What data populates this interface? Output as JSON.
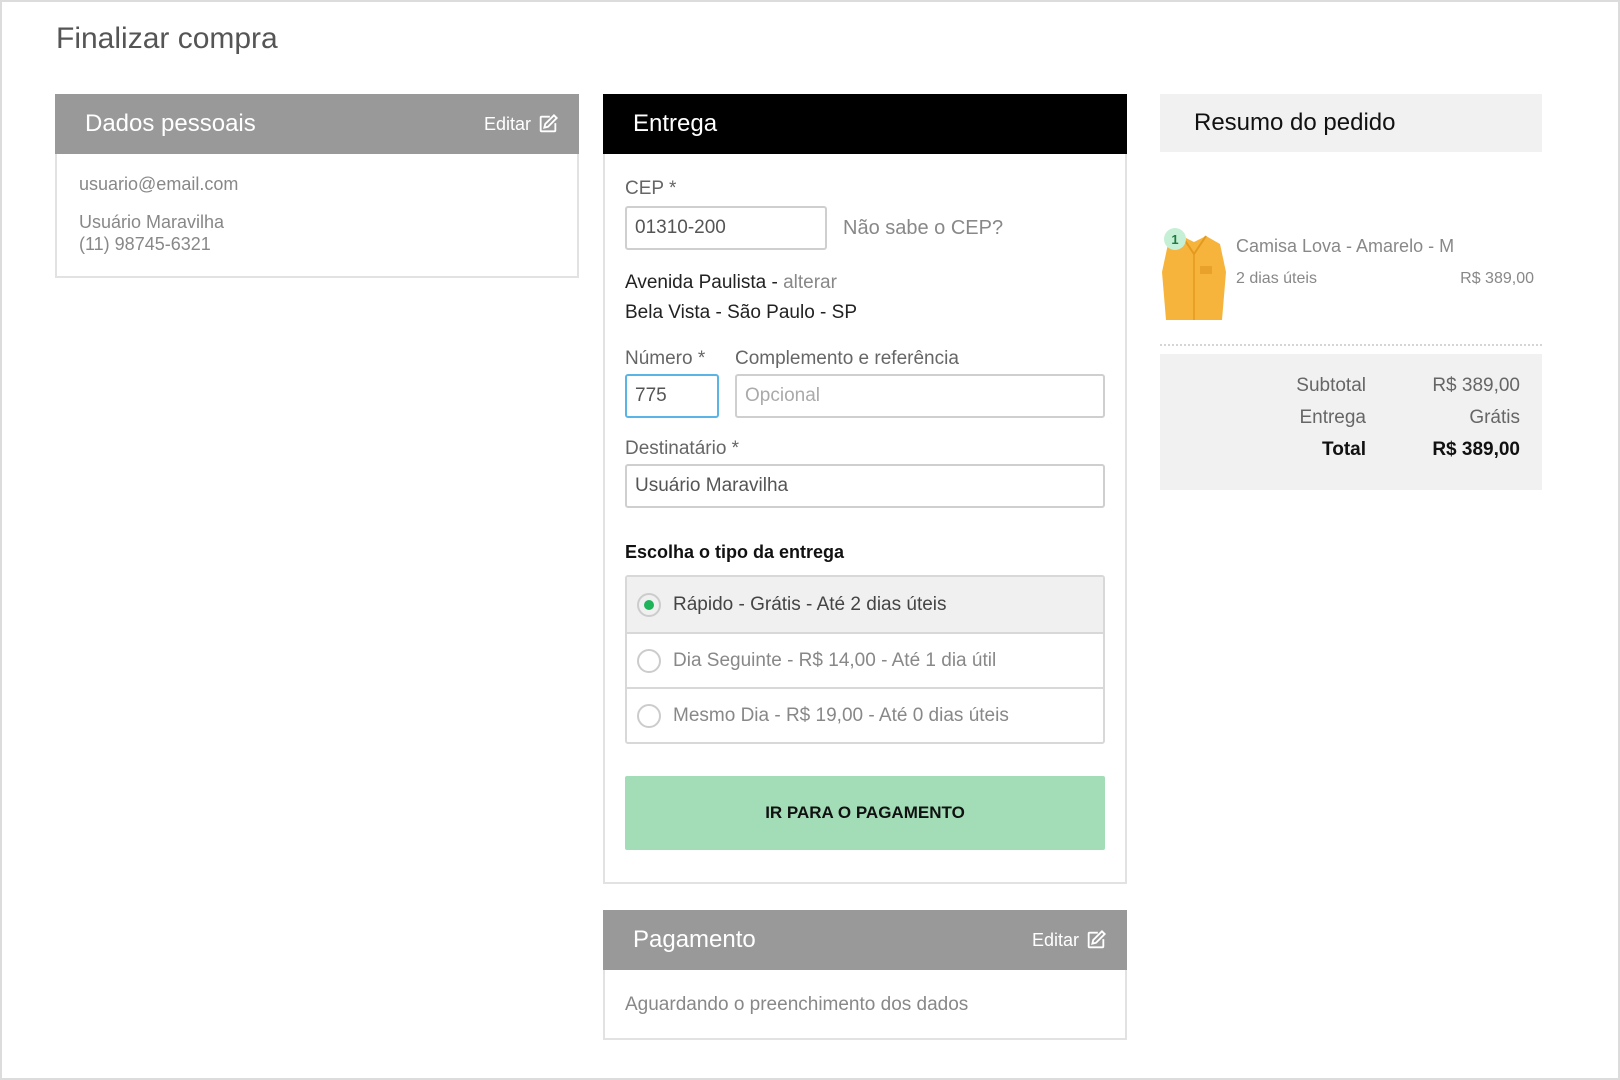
{
  "page": {
    "title": "Finalizar compra"
  },
  "personal": {
    "title": "Dados pessoais",
    "edit_label": "Editar",
    "email": "usuario@email.com",
    "name": "Usuário Maravilha",
    "phone": "(11) 98745-6321"
  },
  "delivery": {
    "title": "Entrega",
    "cep_label": "CEP *",
    "cep_value": "01310-200",
    "cep_help": "Não sabe o CEP?",
    "street": "Avenida Paulista -",
    "change_label": "alterar",
    "city_line": "Bela Vista - São Paulo - SP",
    "number_label": "Número *",
    "number_value": "775",
    "complement_label": "Complemento e referência",
    "complement_placeholder": "Opcional",
    "recipient_label": "Destinatário *",
    "recipient_value": "Usuário Maravilha",
    "shipping_title": "Escolha o tipo da entrega",
    "shipping_options": [
      {
        "label": "Rápido - Grátis - Até 2 dias úteis",
        "selected": true
      },
      {
        "label": "Dia Seguinte - R$ 14,00 - Até 1 dia útil",
        "selected": false
      },
      {
        "label": "Mesmo Dia - R$ 19,00 - Até 0 dias úteis",
        "selected": false
      }
    ],
    "pay_button": "IR PARA O PAGAMENTO"
  },
  "payment": {
    "title": "Pagamento",
    "edit_label": "Editar",
    "status": "Aguardando o preenchimento dos dados"
  },
  "summary": {
    "title": "Resumo do pedido",
    "item": {
      "quantity": "1",
      "name": "Camisa Lova - Amarelo - M",
      "delivery_time": "2 dias úteis",
      "price": "R$ 389,00"
    },
    "subtotal_label": "Subtotal",
    "subtotal_value": "R$ 389,00",
    "shipping_label": "Entrega",
    "shipping_value": "Grátis",
    "total_label": "Total",
    "total_value": "R$ 389,00"
  },
  "colors": {
    "accent_green": "#a3ddb8",
    "radio_green": "#1fb35a",
    "header_gray": "#999999",
    "header_black": "#000000",
    "input_focus": "#5ab4e5",
    "product_yellow": "#f6b43c"
  }
}
